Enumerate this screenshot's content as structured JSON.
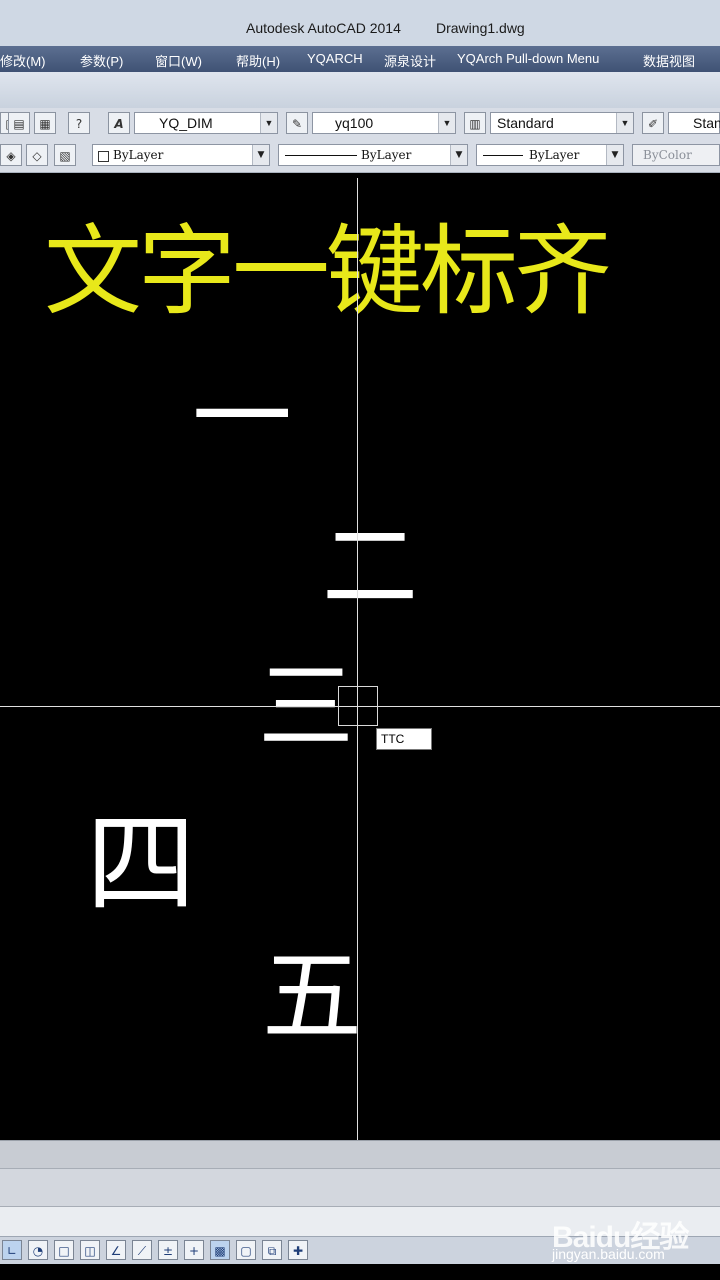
{
  "window": {
    "title": "Autodesk AutoCAD 2014",
    "filename": "Drawing1.dwg"
  },
  "menu": {
    "items": [
      "修改(M)",
      "参数(P)",
      "窗口(W)",
      "帮助(H)",
      "YQARCH",
      "源泉设计",
      "YQArch Pull-down Menu",
      "数据视图"
    ]
  },
  "toolbar1": {
    "dimstyle": "YQ_DIM",
    "multileader": "yq100",
    "tablestyle": "Standard",
    "textstyle": "Stan",
    "help_glyph": "?"
  },
  "toolbar2": {
    "color": "ByLayer",
    "linetype": "ByLayer",
    "lineweight": "ByLayer",
    "plotstyle": "ByColor"
  },
  "canvas": {
    "heading": "文字一键标齐",
    "texts": [
      "一",
      "二",
      "三",
      "四",
      "五"
    ],
    "command_input": "TTC"
  },
  "watermark": {
    "brand": "Baidu经验",
    "url": "jingyan.baidu.com"
  },
  "colors": {
    "heading": "#e8e81a",
    "canvas_bg": "#000000",
    "menubar": "#4a5d80"
  },
  "icons": {
    "toolbar1": [
      "layer-state-icon",
      "layer-properties-icon",
      "calculator-icon",
      "help-icon",
      "text-style-icon",
      "multileader-style-icon",
      "table-style-icon",
      "text-style-brush-icon"
    ],
    "toolbar2": [
      "layer-icon",
      "layer-previous-icon",
      "layer-isolate-icon"
    ],
    "status": [
      "snap-icon",
      "polar-icon",
      "osnap-icon",
      "3d-osnap-icon",
      "otrack-icon",
      "ducs-icon",
      "dyn-icon",
      "lineweight-icon",
      "transparency-icon",
      "quick-properties-icon",
      "selection-cycling-icon",
      "annotation-icon"
    ]
  }
}
